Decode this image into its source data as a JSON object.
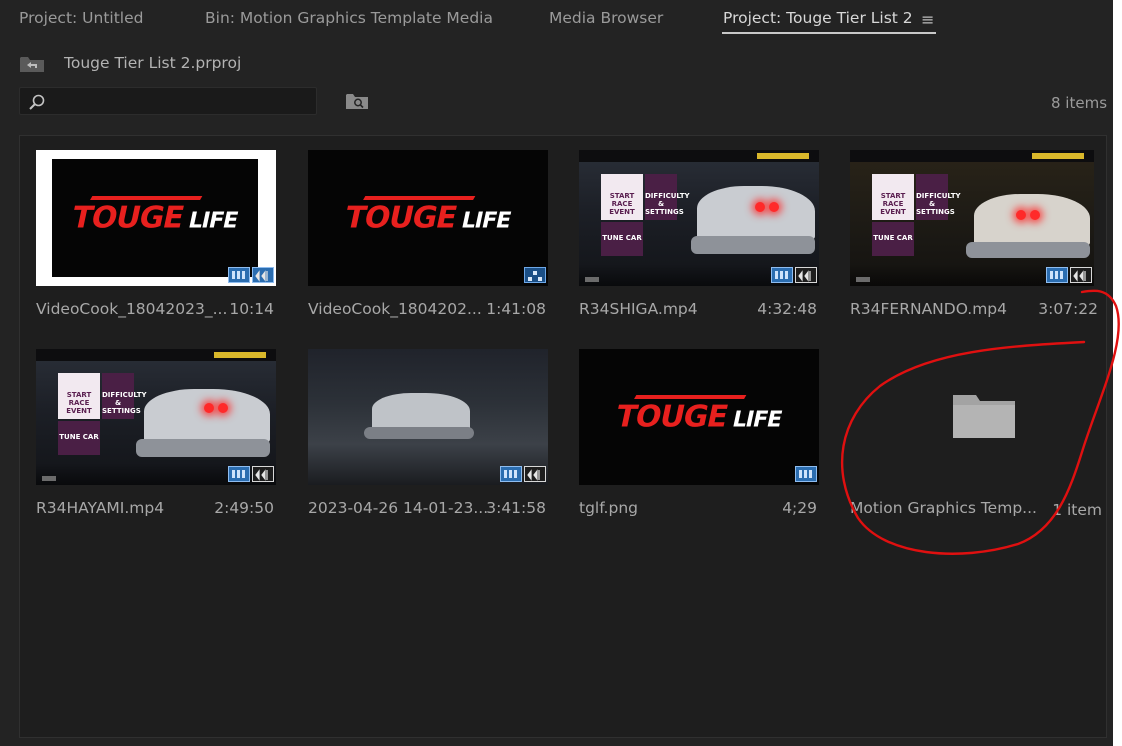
{
  "tabs": [
    {
      "label": "Project: Untitled"
    },
    {
      "label": "Bin: Motion Graphics Template Media"
    },
    {
      "label": "Media Browser"
    },
    {
      "label": "Project: Touge Tier List 2"
    }
  ],
  "tab_menu_glyph": "≡",
  "project": {
    "file_name": "Touge Tier List 2.prproj",
    "item_count": "8 items"
  },
  "search": {
    "value": "",
    "placeholder": ""
  },
  "items": [
    {
      "name": "VideoCook_18042023_...",
      "duration": "10:14"
    },
    {
      "name": "VideoCook_1804202...",
      "duration": "1:41:08"
    },
    {
      "name": "R34SHIGA.mp4",
      "duration": "4:32:48"
    },
    {
      "name": "R34FERNANDO.mp4",
      "duration": "3:07:22"
    },
    {
      "name": "R34HAYAMI.mp4",
      "duration": "2:49:50"
    },
    {
      "name": "2023-04-26 14-01-23...",
      "duration": "3:41:58"
    },
    {
      "name": "tglf.png",
      "duration": "4;29"
    },
    {
      "name": "Motion Graphics Temp...",
      "duration": "1 item"
    }
  ],
  "thumb_text": {
    "logo_touge": "TOUGE",
    "logo_life": " LIFE",
    "menu_start": "START RACE EVENT",
    "menu_difficulty": "DIFFICULTY & SETTINGS",
    "menu_tune": "TUNE CAR"
  },
  "colors": {
    "background": "#232323",
    "panel": "#1e1e1e",
    "video_badge": "#2b6db0",
    "annotation": "#e01010",
    "logo_red": "#e8201e"
  },
  "icons": {
    "up_folder": "folder-up-icon",
    "search": "search-icon",
    "find": "find-in-bin-icon",
    "folder": "folder-icon",
    "video_badge": "film-strip-icon",
    "audio_badge": "audio-waveform-icon",
    "sequence_badge": "sequence-icon"
  }
}
